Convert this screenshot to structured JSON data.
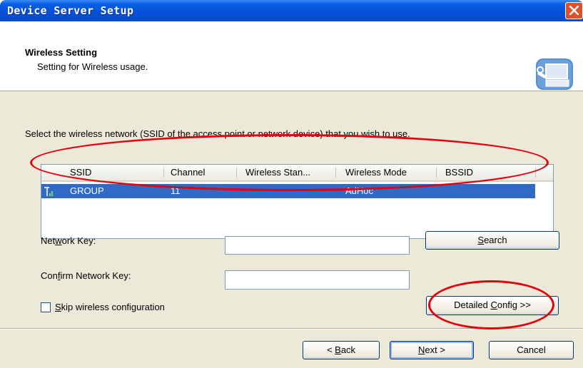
{
  "window": {
    "title": "Device Server Setup",
    "close_icon": "close-icon"
  },
  "header": {
    "title": "Wireless Setting",
    "subtitle": "Setting for Wireless usage.",
    "icon": "computer-wrench-icon"
  },
  "instruction": "Select the wireless network (SSID of the access point or network device) that you wish to use.",
  "network_list": {
    "columns": [
      "SSID",
      "Channel",
      "Wireless Stan...",
      "Wireless Mode",
      "BSSID"
    ],
    "rows": [
      {
        "icon": "signal-icon",
        "ssid": "GROUP",
        "channel": "11",
        "standard": "",
        "mode": "AdHoc",
        "bssid": ""
      }
    ]
  },
  "network_key": {
    "label_pre": "Net",
    "label_u": "w",
    "label_post": "ork Key:",
    "value": ""
  },
  "confirm_key": {
    "label_pre": "Con",
    "label_u": "f",
    "label_post": "irm Network Key:",
    "value": ""
  },
  "search_button": {
    "u": "S",
    "rest": "earch"
  },
  "skip_checkbox": {
    "u": "S",
    "rest": "kip wireless configuration",
    "checked": false
  },
  "detailed_button": {
    "pre": "Detailed ",
    "u": "C",
    "post": "onfig >>"
  },
  "footer": {
    "back": {
      "pre": "< ",
      "u": "B",
      "post": "ack"
    },
    "next": {
      "u": "N",
      "post": "ext >"
    },
    "cancel": "Cancel"
  },
  "colors": {
    "titlebar": "#0450d8",
    "selection": "#316ac5",
    "annotation": "#e4000f",
    "dialog_bg": "#ece9d8"
  }
}
